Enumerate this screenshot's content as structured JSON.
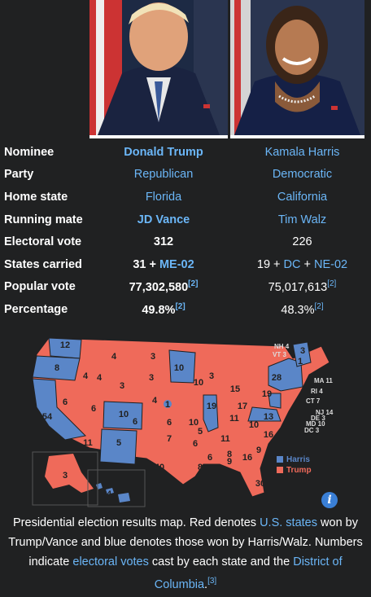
{
  "candidates": {
    "left": {
      "name": "Donald Trump",
      "party": "Republican",
      "home_state": "Florida",
      "running_mate": "JD Vance",
      "electoral_vote": "312",
      "states_carried_prefix": "31 + ",
      "states_carried_link": "ME-02",
      "popular_vote": "77,302,580",
      "popular_vote_ref": "[2]",
      "percentage": "49.8%",
      "percentage_ref": "[2]"
    },
    "right": {
      "name": "Kamala Harris",
      "party": "Democratic",
      "home_state": "California",
      "running_mate": "Tim Walz",
      "electoral_vote": "226",
      "states_carried_prefix": "19 + ",
      "states_carried_link1": "DC",
      "states_carried_mid": " + ",
      "states_carried_link2": "NE-02",
      "popular_vote": "75,017,613",
      "popular_vote_ref": "[2]",
      "percentage": "48.3%",
      "percentage_ref": "[2]"
    }
  },
  "labels": {
    "nominee": "Nominee",
    "party": "Party",
    "home_state": "Home state",
    "running_mate": "Running mate",
    "electoral_vote": "Electoral vote",
    "states_carried": "States carried",
    "popular_vote": "Popular vote",
    "percentage": "Percentage"
  },
  "colors": {
    "trump": "#ef6a5a",
    "harris": "#5a86c8",
    "link": "#6bb6f7",
    "background": "#202122"
  },
  "map": {
    "legend_harris": "Harris",
    "legend_trump": "Trump",
    "state_votes": [
      {
        "label": "12"
      },
      {
        "label": "4"
      },
      {
        "label": "3"
      },
      {
        "label": "8"
      },
      {
        "label": "4"
      },
      {
        "label": "3"
      },
      {
        "label": "10"
      },
      {
        "label": "3"
      },
      {
        "label": "6"
      },
      {
        "label": "6"
      },
      {
        "label": "4"
      },
      {
        "label": "1"
      },
      {
        "label": "10"
      },
      {
        "label": "54"
      },
      {
        "label": "6"
      },
      {
        "label": "6"
      },
      {
        "label": "10"
      },
      {
        "label": "19"
      },
      {
        "label": "15"
      },
      {
        "label": "17"
      },
      {
        "label": "19"
      },
      {
        "label": "28"
      },
      {
        "label": "11"
      },
      {
        "label": "5"
      },
      {
        "label": "7"
      },
      {
        "label": "6"
      },
      {
        "label": "8"
      },
      {
        "label": "11"
      },
      {
        "label": "16"
      },
      {
        "label": "40"
      },
      {
        "label": "8"
      },
      {
        "label": "6"
      },
      {
        "label": "9"
      },
      {
        "label": "16"
      },
      {
        "label": "9"
      },
      {
        "label": "30"
      },
      {
        "label": "3"
      },
      {
        "label": "4"
      },
      {
        "label": "4"
      },
      {
        "label": "13"
      },
      {
        "label": "11"
      },
      {
        "label": "1"
      },
      {
        "label": "3"
      },
      {
        "label": "5"
      },
      {
        "label": "10"
      },
      {
        "label": "10"
      },
      {
        "label": "3"
      }
    ],
    "ne_labels": [
      "NH 4",
      "VT 3",
      "MA 11",
      "RI 4",
      "CT 7",
      "NJ 14",
      "DE 3",
      "MD 10",
      "DC 3"
    ]
  },
  "caption": {
    "part1": "Presidential election results map. Red denotes ",
    "link1": "U.S. states",
    "part2": " won by Trump/Vance and blue denotes those won by Harris/Walz. Numbers indicate ",
    "link2": "electoral votes",
    "part3": " cast by each state and the ",
    "link3": "District of Columbia",
    "part4": ".",
    "ref": "[3]"
  }
}
